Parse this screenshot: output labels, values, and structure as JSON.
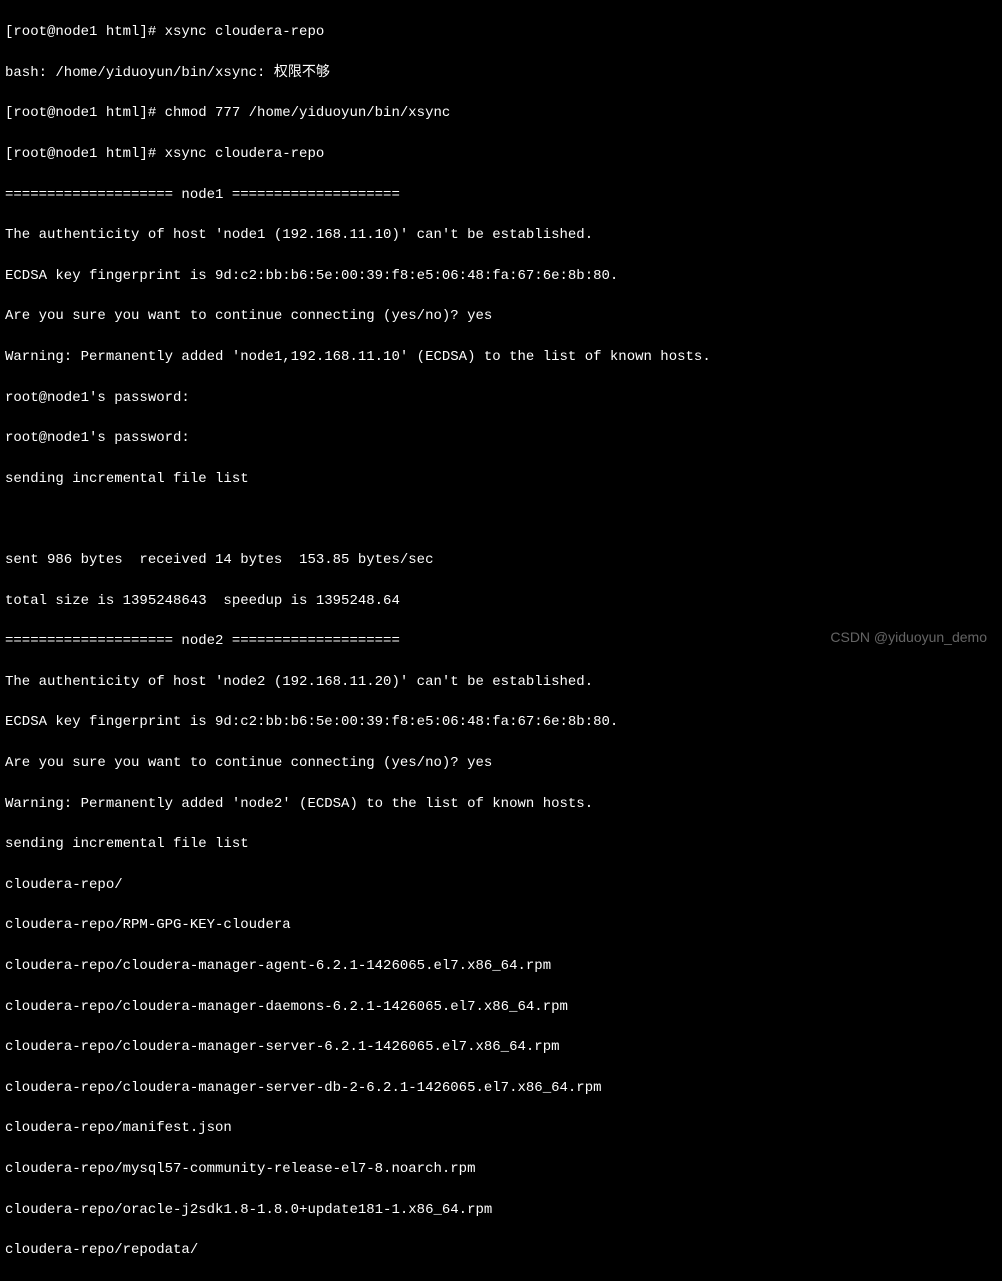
{
  "lines": {
    "l0": "[root@node1 html]# xsync cloudera-repo",
    "l1": "bash: /home/yiduoyun/bin/xsync: 权限不够",
    "l2": "[root@node1 html]# chmod 777 /home/yiduoyun/bin/xsync",
    "l3": "[root@node1 html]# xsync cloudera-repo",
    "l4": "==================== node1 ====================",
    "l5": "The authenticity of host 'node1 (192.168.11.10)' can't be established.",
    "l6": "ECDSA key fingerprint is 9d:c2:bb:b6:5e:00:39:f8:e5:06:48:fa:67:6e:8b:80.",
    "l7": "Are you sure you want to continue connecting (yes/no)? yes",
    "l8": "Warning: Permanently added 'node1,192.168.11.10' (ECDSA) to the list of known hosts.",
    "l9": "root@node1's password: ",
    "l10": "root@node1's password: ",
    "l11": "sending incremental file list",
    "l12": " ",
    "l13": "sent 986 bytes  received 14 bytes  153.85 bytes/sec",
    "l14": "total size is 1395248643  speedup is 1395248.64",
    "l15": "==================== node2 ====================",
    "l16": "The authenticity of host 'node2 (192.168.11.20)' can't be established.",
    "l17": "ECDSA key fingerprint is 9d:c2:bb:b6:5e:00:39:f8:e5:06:48:fa:67:6e:8b:80.",
    "l18": "Are you sure you want to continue connecting (yes/no)? yes",
    "l19": "Warning: Permanently added 'node2' (ECDSA) to the list of known hosts.",
    "l20": "sending incremental file list",
    "l21": "cloudera-repo/",
    "l22": "cloudera-repo/RPM-GPG-KEY-cloudera",
    "l23": "cloudera-repo/cloudera-manager-agent-6.2.1-1426065.el7.x86_64.rpm",
    "l24": "cloudera-repo/cloudera-manager-daemons-6.2.1-1426065.el7.x86_64.rpm",
    "l25": "cloudera-repo/cloudera-manager-server-6.2.1-1426065.el7.x86_64.rpm",
    "l26": "cloudera-repo/cloudera-manager-server-db-2-6.2.1-1426065.el7.x86_64.rpm",
    "l27": "cloudera-repo/manifest.json",
    "l28": "cloudera-repo/mysql57-community-release-el7-8.noarch.rpm",
    "l29": "cloudera-repo/oracle-j2sdk1.8-1.8.0+update181-1.x86_64.rpm",
    "l30": "cloudera-repo/repodata/"
  },
  "watermark": "CSDN @yiduoyun_demo"
}
